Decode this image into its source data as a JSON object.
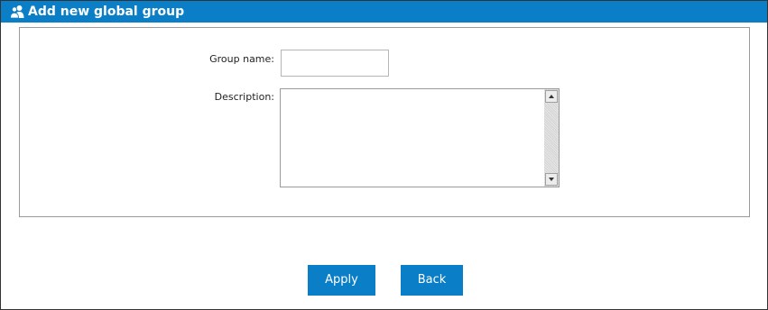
{
  "header": {
    "title": "Add new global group",
    "icon": "users-icon",
    "background_color": "#0a7ec6"
  },
  "form": {
    "group_name": {
      "label": "Group name:",
      "value": ""
    },
    "description": {
      "label": "Description:",
      "value": ""
    }
  },
  "actions": {
    "apply_label": "Apply",
    "back_label": "Back",
    "button_color": "#0a7ec6"
  }
}
